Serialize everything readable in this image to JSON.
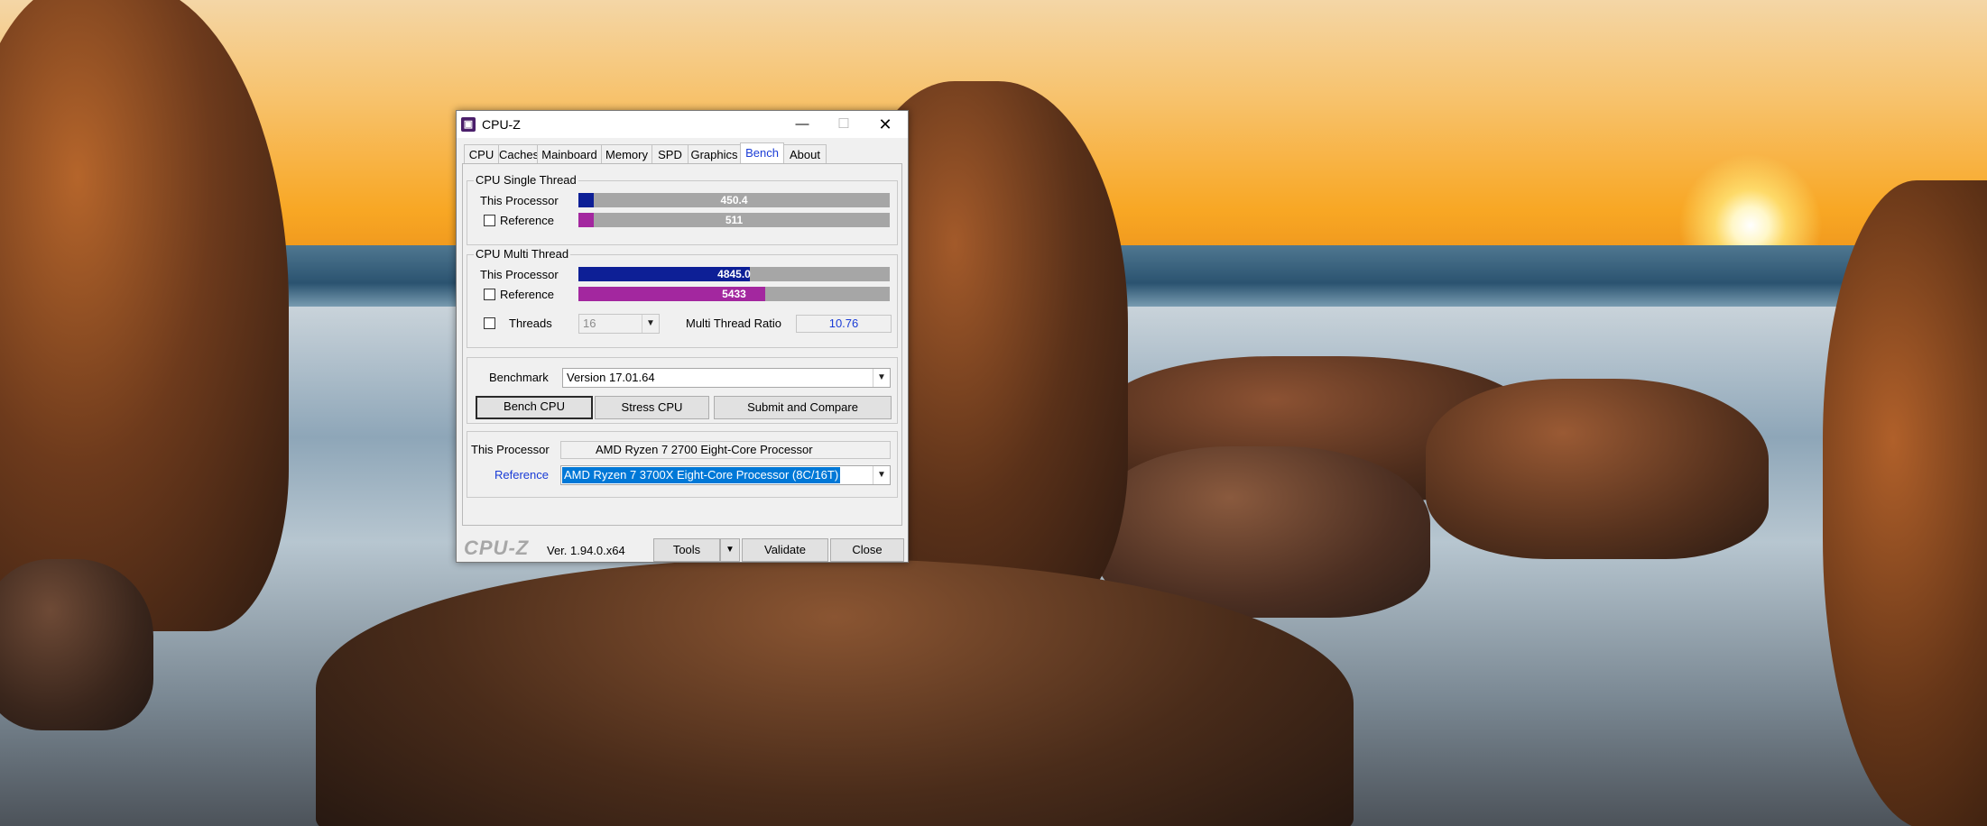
{
  "window": {
    "title": "CPU-Z",
    "icon": "cpu-z-icon",
    "controls": {
      "minimize": "—",
      "maximize": "☐",
      "close": "✕"
    }
  },
  "tabs": [
    {
      "label": "CPU"
    },
    {
      "label": "Caches"
    },
    {
      "label": "Mainboard"
    },
    {
      "label": "Memory"
    },
    {
      "label": "SPD"
    },
    {
      "label": "Graphics"
    },
    {
      "label": "Bench",
      "active": true
    },
    {
      "label": "About"
    }
  ],
  "single_thread": {
    "title": "CPU Single Thread",
    "this_label": "This Processor",
    "this_value": "450.4",
    "this_fraction": 0.05,
    "ref_label": "Reference",
    "ref_value": "511",
    "ref_fraction": 0.05
  },
  "multi_thread": {
    "title": "CPU Multi Thread",
    "this_label": "This Processor",
    "this_value": "4845.0",
    "this_fraction": 0.552,
    "ref_label": "Reference",
    "ref_value": "5433",
    "ref_fraction": 0.6,
    "threads_label": "Threads",
    "threads_value": "16",
    "ratio_label": "Multi Thread Ratio",
    "ratio_value": "10.76"
  },
  "benchmark": {
    "label": "Benchmark",
    "version": "Version 17.01.64",
    "buttons": {
      "bench": "Bench CPU",
      "stress": "Stress CPU",
      "submit": "Submit and Compare"
    }
  },
  "compare": {
    "this_label": "This Processor",
    "this_value": "AMD Ryzen 7 2700 Eight-Core Processor",
    "ref_label": "Reference",
    "ref_value": "AMD Ryzen 7 3700X Eight-Core Processor (8C/16T)"
  },
  "footer": {
    "logo": "CPU-Z",
    "version": "Ver. 1.94.0.x64",
    "tools": "Tools",
    "validate": "Validate",
    "close": "Close"
  },
  "colors": {
    "this_bar": "#0d1f96",
    "ref_bar": "#a3279f",
    "active_tab_text": "#1a3cd6",
    "selection": "#0078d7"
  }
}
